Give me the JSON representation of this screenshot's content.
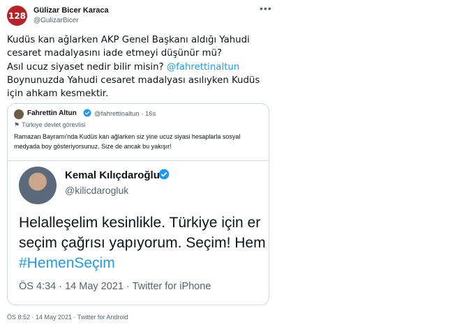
{
  "tweet": {
    "avatar_text": "128",
    "author_name": "Gülizar Bicer Karaca",
    "author_handle": "@GulizarBicer",
    "more_icon": "ellipsis-icon",
    "line1": "Kudüs kan ağlarken AKP Genel Başkanı aldığı Yahudi",
    "line2": "cesaret madalyasını iade etmeyi düşünür mü?",
    "line3_prefix": "Asıl ucuz siyaset nedir bilir misin? ",
    "mention": "@fahrettinaltun",
    "line4": "Boynunuzda Yahudi cesaret madalyası asılıyken Kudüs",
    "line5": "için ahkam kesmektir.",
    "footer": "ÖS 8:52 · 14 May 2021 · Twitter for Android"
  },
  "quote": {
    "author_name": "Fahrettin Altun",
    "meta": "@fahrettinaltun · 16s",
    "label_icon": "flag-icon",
    "label": "Türkiye devlet görevlisi",
    "text": "Ramazan Bayramı'nda Kudüs kan ağlarken siz yine ucuz siyasi hesaplarla sosyal medyada boy gösteriyorsunuz. Size de ancak bu yakışır!",
    "verified_color": "#1d9bf0"
  },
  "embedded": {
    "author_name": "Kemal Kılıçdaroğlu",
    "author_handle": "@kilicdarogluk",
    "line1": "Helalleşelim kesinlikle. Türkiye için er",
    "line2": "seçim çağrısı yapıyorum. Seçim! Hem",
    "hashtag": "#HemenSeçim",
    "meta": "ÖS 4:34 · 14 May 2021 · Twitter for iPhone"
  }
}
